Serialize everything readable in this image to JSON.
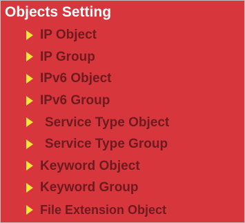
{
  "panel": {
    "title": "Objects Setting",
    "colors": {
      "background": "#d8363d",
      "title_text": "#ffffff",
      "item_text": "#6e1a1e",
      "arrow": "#ffe23a"
    },
    "items": [
      {
        "label": "IP Object",
        "icon": "right-triangle-icon"
      },
      {
        "label": "IP Group",
        "icon": "right-triangle-icon"
      },
      {
        "label": "IPv6 Object",
        "icon": "right-triangle-icon"
      },
      {
        "label": "IPv6 Group",
        "icon": "right-triangle-icon"
      },
      {
        "label": "Service Type Object",
        "icon": "right-triangle-icon"
      },
      {
        "label": "Service Type Group",
        "icon": "right-triangle-icon"
      },
      {
        "label": "Keyword Object",
        "icon": "right-triangle-icon"
      },
      {
        "label": "Keyword Group",
        "icon": "right-triangle-icon"
      },
      {
        "label": "File Extension Object",
        "icon": "right-triangle-icon"
      }
    ]
  }
}
